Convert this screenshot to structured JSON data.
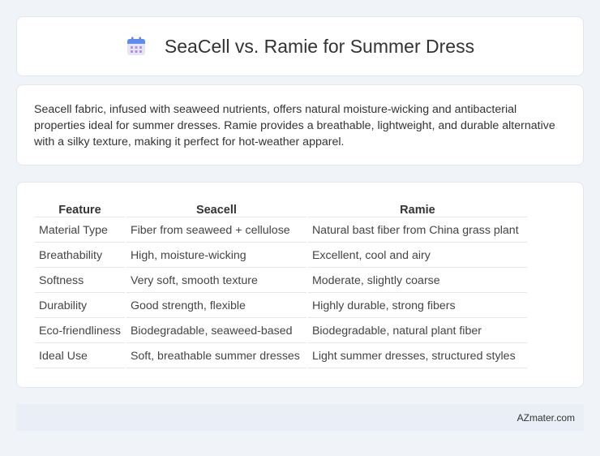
{
  "header": {
    "title": "SeaCell vs. Ramie for Summer Dress",
    "icon": "calendar-icon"
  },
  "intro": {
    "text": "Seacell fabric, infused with seaweed nutrients, offers natural moisture-wicking and antibacterial properties ideal for summer dresses. Ramie provides a breathable, lightweight, and durable alternative with a silky texture, making it perfect for hot-weather apparel."
  },
  "table": {
    "headers": [
      "Feature",
      "Seacell",
      "Ramie"
    ],
    "rows": [
      [
        "Material Type",
        "Fiber from seaweed + cellulose",
        "Natural bast fiber from China grass plant"
      ],
      [
        "Breathability",
        "High, moisture-wicking",
        "Excellent, cool and airy"
      ],
      [
        "Softness",
        "Very soft, smooth texture",
        "Moderate, slightly coarse"
      ],
      [
        "Durability",
        "Good strength, flexible",
        "Highly durable, strong fibers"
      ],
      [
        "Eco-friendliness",
        "Biodegradable, seaweed-based",
        "Biodegradable, natural plant fiber"
      ],
      [
        "Ideal Use",
        "Soft, breathable summer dresses",
        "Light summer dresses, structured styles"
      ]
    ]
  },
  "footer": {
    "text": "AZmater.com"
  }
}
